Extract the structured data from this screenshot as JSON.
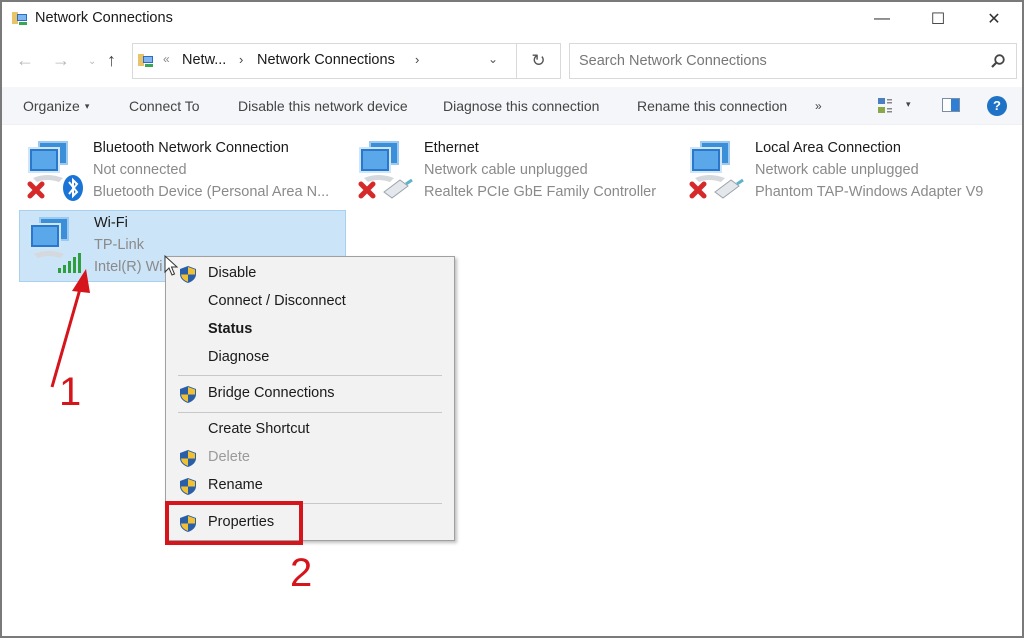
{
  "window": {
    "title": "Network Connections",
    "controls": {
      "minimize": "—",
      "maximize": "☐",
      "close": "✕"
    }
  },
  "navigation": {
    "back": "←",
    "forward": "→",
    "recent": "⌄",
    "up": "↑",
    "address": {
      "overflow": "«",
      "crumbs": [
        "Netw...",
        "Network Connections"
      ],
      "separator": "›",
      "dropdown": "⌄"
    },
    "refresh": "↻",
    "search": {
      "placeholder": "Search Network Connections"
    }
  },
  "commandbar": {
    "organize": "Organize",
    "organize_caret": "▾",
    "connect_to": "Connect To",
    "disable_device": "Disable this network device",
    "diagnose": "Diagnose this connection",
    "rename": "Rename this connection",
    "more": "»",
    "view_caret": "▾",
    "help": "?"
  },
  "connections": [
    {
      "name": "Bluetooth Network Connection",
      "status": "Not connected",
      "device": "Bluetooth Device (Personal Area N...",
      "icon": "bluetooth-disconnected"
    },
    {
      "name": "Ethernet",
      "status": "Network cable unplugged",
      "device": "Realtek PCIe GbE Family Controller",
      "icon": "ethernet-unplugged"
    },
    {
      "name": "Local Area Connection",
      "status": "Network cable unplugged",
      "device": "Phantom TAP-Windows Adapter V9",
      "icon": "ethernet-unplugged"
    },
    {
      "name": "Wi-Fi",
      "status": "TP-Link",
      "device": "Intel(R) Wi",
      "icon": "wifi-connected",
      "selected": true
    }
  ],
  "context_menu": {
    "items": [
      {
        "label": "Disable",
        "shield": true
      },
      {
        "label": "Connect / Disconnect",
        "shield": false
      },
      {
        "label": "Status",
        "shield": false,
        "bold": true
      },
      {
        "label": "Diagnose",
        "shield": false
      },
      {
        "label": "Bridge Connections",
        "shield": true
      },
      {
        "label": "Create Shortcut",
        "shield": false
      },
      {
        "label": "Delete",
        "shield": true,
        "disabled": true
      },
      {
        "label": "Rename",
        "shield": true
      },
      {
        "label": "Properties",
        "shield": true
      }
    ]
  },
  "annotations": {
    "step1": "1",
    "step2": "2",
    "color": "#d6141c"
  }
}
